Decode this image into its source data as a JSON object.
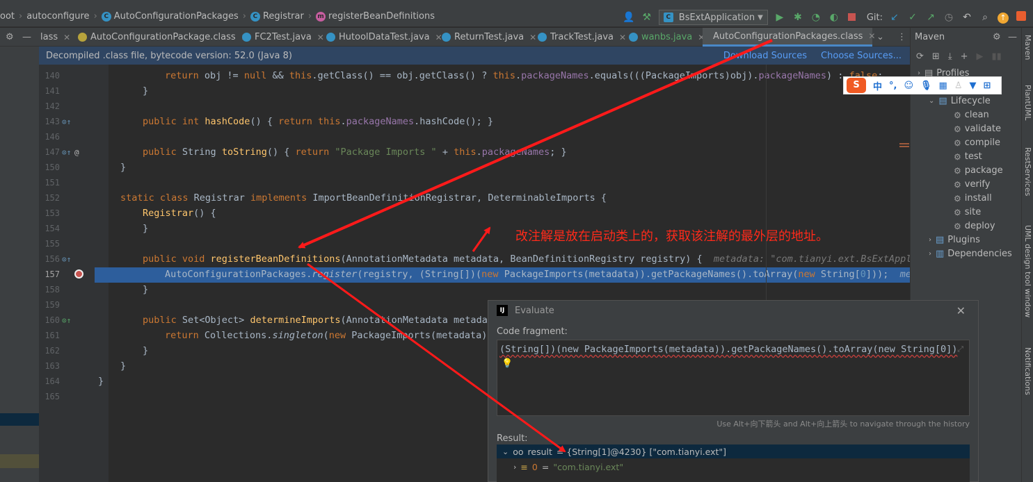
{
  "breadcrumbs": [
    "oot",
    "autoconfigure",
    "AutoConfigurationPackages",
    "Registrar",
    "registerBeanDefinitions"
  ],
  "run_config": "BsExtApplication",
  "git_label": "Git:",
  "tabs": [
    {
      "label": "lass",
      "active": false
    },
    {
      "label": "AutoConfigurationPackage.class",
      "active": false
    },
    {
      "label": "FC2Test.java",
      "active": false
    },
    {
      "label": "HutoolDataTest.java",
      "active": false
    },
    {
      "label": "ReturnTest.java",
      "active": false
    },
    {
      "label": "TrackTest.java",
      "active": false
    },
    {
      "label": "wanbs.java",
      "active": false
    },
    {
      "label": "AutoConfigurationPackages.class",
      "active": true
    }
  ],
  "notification": {
    "text": "Decompiled .class file, bytecode version: 52.0 (Java 8)",
    "download_sources": "Download Sources",
    "choose_sources": "Choose Sources..."
  },
  "line_numbers": [
    "140",
    "141",
    "142",
    "143",
    "146",
    "147",
    "150",
    "151",
    "152",
    "153",
    "154",
    "155",
    "156",
    "157",
    "158",
    "159",
    "160",
    "161",
    "162",
    "163",
    "164",
    "165"
  ],
  "code": {
    "l140": "return obj != null && this.getClass() == obj.getClass() ? this.packageNames.equals(((PackageImports)obj).packageNames) : false;",
    "l141": "}",
    "l143": "public int hashCode() { return this.packageNames.hashCode(); }",
    "l147": "public String toString() { return \"Package Imports \" + this.packageNames; }",
    "l150": "}",
    "l152": "static class Registrar implements ImportBeanDefinitionRegistrar, DeterminableImports {",
    "l153": "Registrar() {",
    "l154": "}",
    "l156": "public void registerBeanDefinitions(AnnotationMetadata metadata, BeanDefinitionRegistry registry) {",
    "l156_hint": "metadata: \"com.tianyi.ext.BsExtApplic",
    "l157": "AutoConfigurationPackages.register(registry, (String[])(new PackageImports(metadata)).getPackageNames().toArray(new String[0]));",
    "l157_hint": "met",
    "l158": "}",
    "l160": "public Set<Object> determineImports(AnnotationMetadata metadat",
    "l161": "return Collections.singleton(new PackageImports(metadata))",
    "l162": "}",
    "l163": "}",
    "l164": "}"
  },
  "maven": {
    "title": "Maven",
    "profiles": "Profiles",
    "lifecycle": "Lifecycle",
    "phases": [
      "clean",
      "validate",
      "compile",
      "test",
      "package",
      "verify",
      "install",
      "site",
      "deploy"
    ],
    "plugins": "Plugins",
    "dependencies": "Dependencies"
  },
  "right_strip": [
    "Maven",
    "PlantUML",
    "RestServices",
    "UML design tool window",
    "Notifications"
  ],
  "annotation_text": "改注解是放在启动类上的，获取该注解的最外层的地址。",
  "ime": {
    "chars": [
      "中",
      "°,"
    ]
  },
  "evaluate": {
    "title": "Evaluate",
    "code_fragment_label": "Code fragment:",
    "code_fragment": "(String[])(new PackageImports(metadata)).getPackageNames().toArray(new String[0])",
    "history_hint": "Use Alt+向下箭头 and Alt+向上箭头 to navigate through the history",
    "result_label": "Result:",
    "result_name": "result",
    "result_value": "= {String[1]@4230} [\"com.tianyi.ext\"]",
    "item_index": "0",
    "item_value": "\"com.tianyi.ext\""
  }
}
